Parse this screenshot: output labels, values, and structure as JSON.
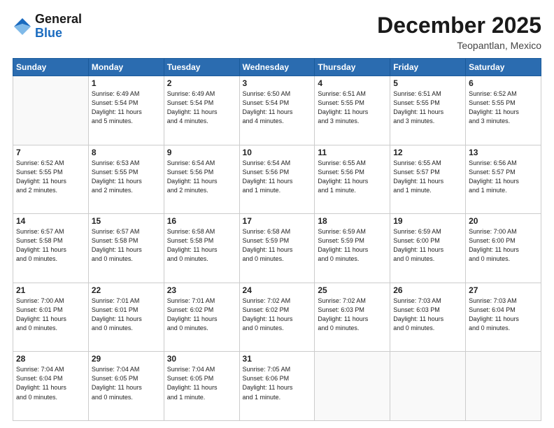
{
  "header": {
    "logo_general": "General",
    "logo_blue": "Blue",
    "month_title": "December 2025",
    "location": "Teopantlan, Mexico"
  },
  "weekdays": [
    "Sunday",
    "Monday",
    "Tuesday",
    "Wednesday",
    "Thursday",
    "Friday",
    "Saturday"
  ],
  "weeks": [
    [
      {
        "day": "",
        "info": ""
      },
      {
        "day": "1",
        "info": "Sunrise: 6:49 AM\nSunset: 5:54 PM\nDaylight: 11 hours\nand 5 minutes."
      },
      {
        "day": "2",
        "info": "Sunrise: 6:49 AM\nSunset: 5:54 PM\nDaylight: 11 hours\nand 4 minutes."
      },
      {
        "day": "3",
        "info": "Sunrise: 6:50 AM\nSunset: 5:54 PM\nDaylight: 11 hours\nand 4 minutes."
      },
      {
        "day": "4",
        "info": "Sunrise: 6:51 AM\nSunset: 5:55 PM\nDaylight: 11 hours\nand 3 minutes."
      },
      {
        "day": "5",
        "info": "Sunrise: 6:51 AM\nSunset: 5:55 PM\nDaylight: 11 hours\nand 3 minutes."
      },
      {
        "day": "6",
        "info": "Sunrise: 6:52 AM\nSunset: 5:55 PM\nDaylight: 11 hours\nand 3 minutes."
      }
    ],
    [
      {
        "day": "7",
        "info": "Sunrise: 6:52 AM\nSunset: 5:55 PM\nDaylight: 11 hours\nand 2 minutes."
      },
      {
        "day": "8",
        "info": "Sunrise: 6:53 AM\nSunset: 5:55 PM\nDaylight: 11 hours\nand 2 minutes."
      },
      {
        "day": "9",
        "info": "Sunrise: 6:54 AM\nSunset: 5:56 PM\nDaylight: 11 hours\nand 2 minutes."
      },
      {
        "day": "10",
        "info": "Sunrise: 6:54 AM\nSunset: 5:56 PM\nDaylight: 11 hours\nand 1 minute."
      },
      {
        "day": "11",
        "info": "Sunrise: 6:55 AM\nSunset: 5:56 PM\nDaylight: 11 hours\nand 1 minute."
      },
      {
        "day": "12",
        "info": "Sunrise: 6:55 AM\nSunset: 5:57 PM\nDaylight: 11 hours\nand 1 minute."
      },
      {
        "day": "13",
        "info": "Sunrise: 6:56 AM\nSunset: 5:57 PM\nDaylight: 11 hours\nand 1 minute."
      }
    ],
    [
      {
        "day": "14",
        "info": "Sunrise: 6:57 AM\nSunset: 5:58 PM\nDaylight: 11 hours\nand 0 minutes."
      },
      {
        "day": "15",
        "info": "Sunrise: 6:57 AM\nSunset: 5:58 PM\nDaylight: 11 hours\nand 0 minutes."
      },
      {
        "day": "16",
        "info": "Sunrise: 6:58 AM\nSunset: 5:58 PM\nDaylight: 11 hours\nand 0 minutes."
      },
      {
        "day": "17",
        "info": "Sunrise: 6:58 AM\nSunset: 5:59 PM\nDaylight: 11 hours\nand 0 minutes."
      },
      {
        "day": "18",
        "info": "Sunrise: 6:59 AM\nSunset: 5:59 PM\nDaylight: 11 hours\nand 0 minutes."
      },
      {
        "day": "19",
        "info": "Sunrise: 6:59 AM\nSunset: 6:00 PM\nDaylight: 11 hours\nand 0 minutes."
      },
      {
        "day": "20",
        "info": "Sunrise: 7:00 AM\nSunset: 6:00 PM\nDaylight: 11 hours\nand 0 minutes."
      }
    ],
    [
      {
        "day": "21",
        "info": "Sunrise: 7:00 AM\nSunset: 6:01 PM\nDaylight: 11 hours\nand 0 minutes."
      },
      {
        "day": "22",
        "info": "Sunrise: 7:01 AM\nSunset: 6:01 PM\nDaylight: 11 hours\nand 0 minutes."
      },
      {
        "day": "23",
        "info": "Sunrise: 7:01 AM\nSunset: 6:02 PM\nDaylight: 11 hours\nand 0 minutes."
      },
      {
        "day": "24",
        "info": "Sunrise: 7:02 AM\nSunset: 6:02 PM\nDaylight: 11 hours\nand 0 minutes."
      },
      {
        "day": "25",
        "info": "Sunrise: 7:02 AM\nSunset: 6:03 PM\nDaylight: 11 hours\nand 0 minutes."
      },
      {
        "day": "26",
        "info": "Sunrise: 7:03 AM\nSunset: 6:03 PM\nDaylight: 11 hours\nand 0 minutes."
      },
      {
        "day": "27",
        "info": "Sunrise: 7:03 AM\nSunset: 6:04 PM\nDaylight: 11 hours\nand 0 minutes."
      }
    ],
    [
      {
        "day": "28",
        "info": "Sunrise: 7:04 AM\nSunset: 6:04 PM\nDaylight: 11 hours\nand 0 minutes."
      },
      {
        "day": "29",
        "info": "Sunrise: 7:04 AM\nSunset: 6:05 PM\nDaylight: 11 hours\nand 0 minutes."
      },
      {
        "day": "30",
        "info": "Sunrise: 7:04 AM\nSunset: 6:05 PM\nDaylight: 11 hours\nand 1 minute."
      },
      {
        "day": "31",
        "info": "Sunrise: 7:05 AM\nSunset: 6:06 PM\nDaylight: 11 hours\nand 1 minute."
      },
      {
        "day": "",
        "info": ""
      },
      {
        "day": "",
        "info": ""
      },
      {
        "day": "",
        "info": ""
      }
    ]
  ]
}
